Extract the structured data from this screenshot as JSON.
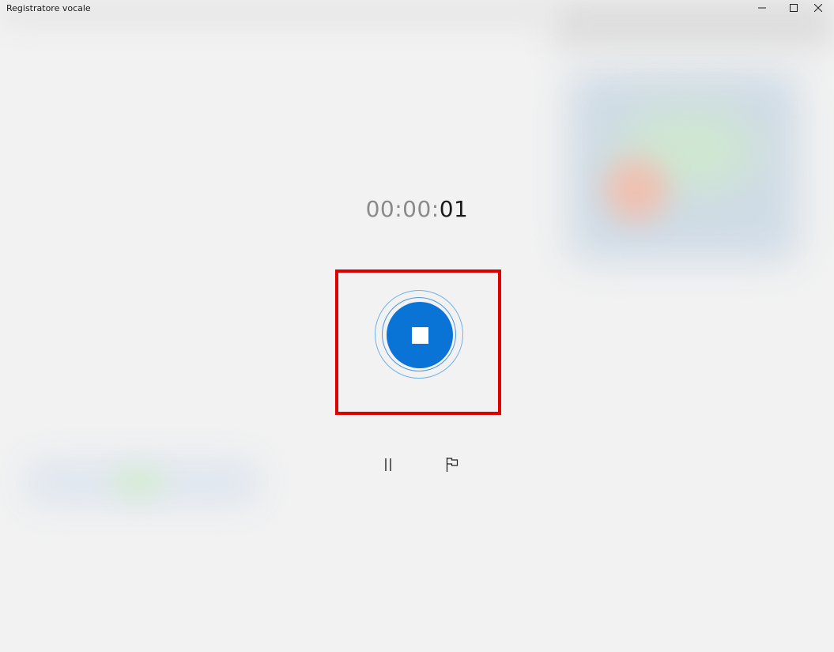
{
  "window": {
    "title": "Registratore vocale",
    "controls": {
      "minimize_icon": "minimize-icon",
      "maximize_icon": "maximize-icon",
      "close_icon": "close-icon"
    }
  },
  "recorder": {
    "timer": {
      "hours_minutes": "00:00:",
      "seconds": "01"
    },
    "stop_button": {
      "icon": "stop-icon",
      "accent_color": "#0a74d6"
    },
    "highlight_color": "#e10000",
    "secondary_controls": [
      {
        "name": "pause",
        "icon": "pause-icon"
      },
      {
        "name": "flag",
        "icon": "flag-icon"
      }
    ]
  }
}
